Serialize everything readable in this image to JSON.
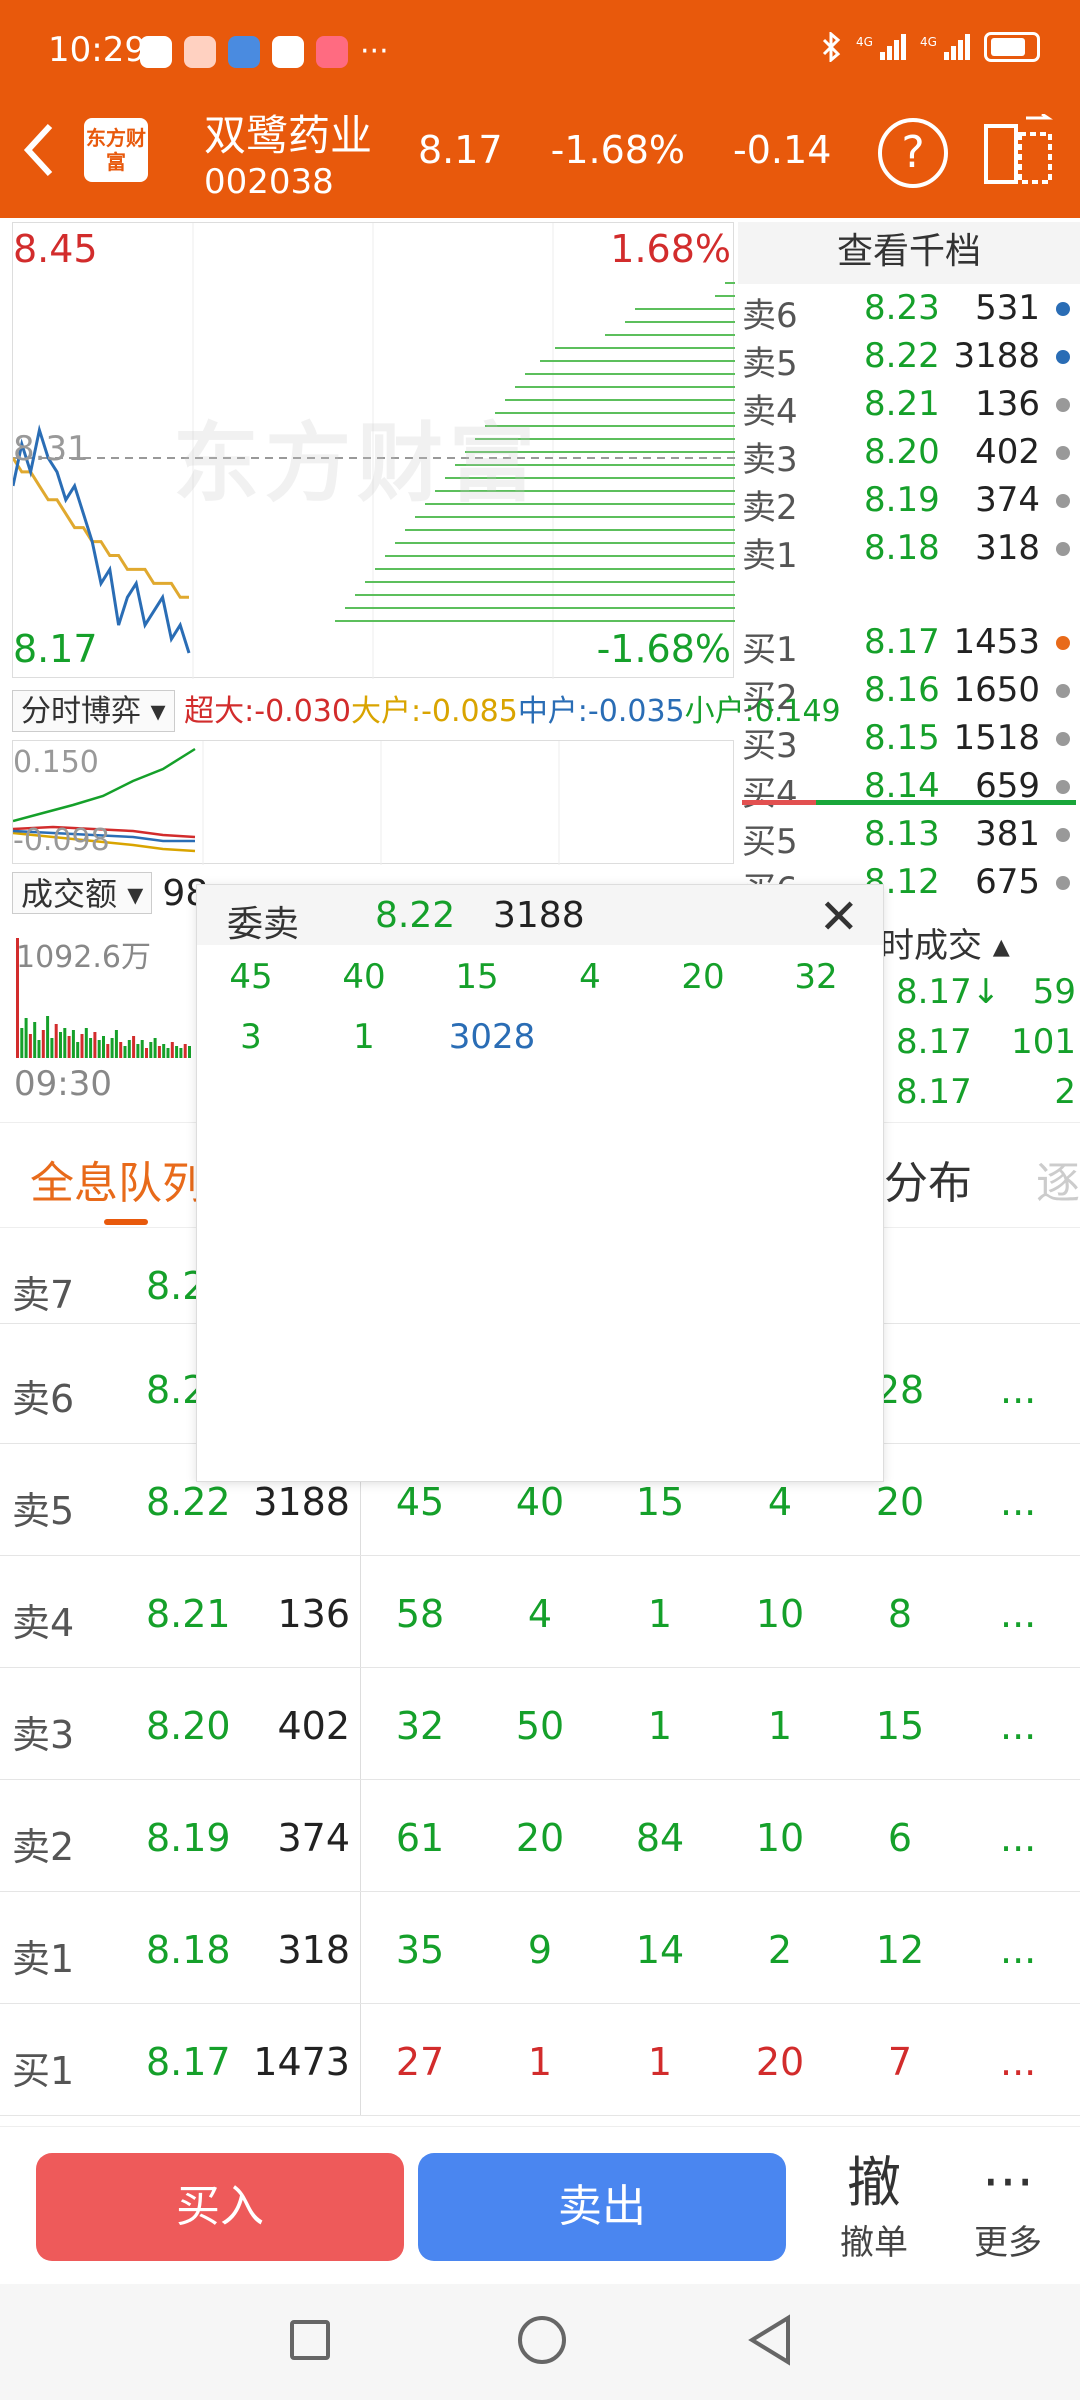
{
  "status_bar": {
    "time": "10:29",
    "more": "···"
  },
  "header": {
    "stock_name": "双鹭药业",
    "stock_code": "002038",
    "price": "8.17",
    "change_pct": "-1.68%",
    "change": "-0.14",
    "logo_text": "东方财富"
  },
  "chart": {
    "high_price": "8.45",
    "low_price": "8.17",
    "pre_close": "8.31",
    "high_pct": "1.68%",
    "low_pct": "-1.68%",
    "watermark": "东方财富",
    "price_series": [
      8.29,
      8.32,
      8.3,
      8.33,
      8.31,
      8.3,
      8.28,
      8.29,
      8.27,
      8.25,
      8.22,
      8.23,
      8.19,
      8.21,
      8.22,
      8.19,
      8.2,
      8.21,
      8.18,
      8.19,
      8.17
    ],
    "avg_series": [
      8.31,
      8.3,
      8.3,
      8.29,
      8.28,
      8.28,
      8.27,
      8.26,
      8.26,
      8.25,
      8.25,
      8.24,
      8.24,
      8.23,
      8.23,
      8.23,
      8.22,
      8.22,
      8.22,
      8.21,
      8.21
    ]
  },
  "orderbook": {
    "title": "查看千档",
    "asks": [
      {
        "label": "卖6",
        "price": "8.23",
        "vol": "531",
        "dot": "#2a6db5"
      },
      {
        "label": "卖5",
        "price": "8.22",
        "vol": "3188",
        "dot": "#2a6db5"
      },
      {
        "label": "卖4",
        "price": "8.21",
        "vol": "136",
        "dot": "#999999"
      },
      {
        "label": "卖3",
        "price": "8.20",
        "vol": "402",
        "dot": "#999999"
      },
      {
        "label": "卖2",
        "price": "8.19",
        "vol": "374",
        "dot": "#999999"
      },
      {
        "label": "卖1",
        "price": "8.18",
        "vol": "318",
        "dot": "#999999"
      }
    ],
    "bids": [
      {
        "label": "买1",
        "price": "8.17",
        "vol": "1453",
        "dot": "#e86a1a"
      },
      {
        "label": "买2",
        "price": "8.16",
        "vol": "1650",
        "dot": "#999999"
      },
      {
        "label": "买3",
        "price": "8.15",
        "vol": "1518",
        "dot": "#999999"
      },
      {
        "label": "买4",
        "price": "8.14",
        "vol": "659",
        "dot": "#999999"
      },
      {
        "label": "买5",
        "price": "8.13",
        "vol": "381",
        "dot": "#999999"
      },
      {
        "label": "买6",
        "price": "8.12",
        "vol": "675",
        "dot": "#999999"
      }
    ]
  },
  "indicator": {
    "dropdown": "分时博弈",
    "super": "超大:-0.030",
    "large": "大户:-0.085",
    "medium": "中户:-0.035",
    "small": "小户:0.149",
    "top_label": "0.150",
    "bottom_label": "-0.098"
  },
  "volume": {
    "dropdown": "成交额",
    "amount": "98",
    "max_label": "1092.6万",
    "start_time": "09:30"
  },
  "trades": {
    "title": "时成交",
    "rows": [
      {
        "price": "8.17↓",
        "vol": "59"
      },
      {
        "price": "8.17",
        "vol": "101"
      },
      {
        "price": "8.17",
        "vol": "2"
      }
    ]
  },
  "tabs": {
    "active": "全息队列",
    "distribution": "分布",
    "partial": "逐"
  },
  "queue": [
    {
      "label": "卖7",
      "price": "8.2",
      "vol": "",
      "cells": [
        "",
        "",
        "",
        "",
        ""
      ],
      "more": ""
    },
    {
      "label": "卖6",
      "price": "8.2",
      "vol": "",
      "cells": [
        "",
        "",
        "",
        "",
        "28"
      ],
      "more": "..."
    },
    {
      "label": "卖5",
      "price": "8.22",
      "vol": "3188",
      "cells": [
        "45",
        "40",
        "15",
        "4",
        "20"
      ],
      "more": "..."
    },
    {
      "label": "卖4",
      "price": "8.21",
      "vol": "136",
      "cells": [
        "58",
        "4",
        "1",
        "10",
        "8"
      ],
      "more": "..."
    },
    {
      "label": "卖3",
      "price": "8.20",
      "vol": "402",
      "cells": [
        "32",
        "50",
        "1",
        "1",
        "15"
      ],
      "more": "..."
    },
    {
      "label": "卖2",
      "price": "8.19",
      "vol": "374",
      "cells": [
        "61",
        "20",
        "84",
        "10",
        "6"
      ],
      "more": "..."
    },
    {
      "label": "卖1",
      "price": "8.18",
      "vol": "318",
      "cells": [
        "35",
        "9",
        "14",
        "2",
        "12"
      ],
      "more": "..."
    },
    {
      "label": "买1",
      "price": "8.17",
      "vol": "1473",
      "cells": [
        "27",
        "1",
        "1",
        "20",
        "7"
      ],
      "more": "..."
    }
  ],
  "popup": {
    "title": "委卖",
    "price": "8.22",
    "total": "3188",
    "row1": [
      "45",
      "40",
      "15",
      "4",
      "20",
      "32"
    ],
    "row2": [
      "3",
      "1",
      "3028"
    ]
  },
  "bottom": {
    "buy": "买入",
    "sell": "卖出",
    "cancel_big": "撤",
    "cancel": "撤单",
    "more_big": "···",
    "more": "更多"
  }
}
